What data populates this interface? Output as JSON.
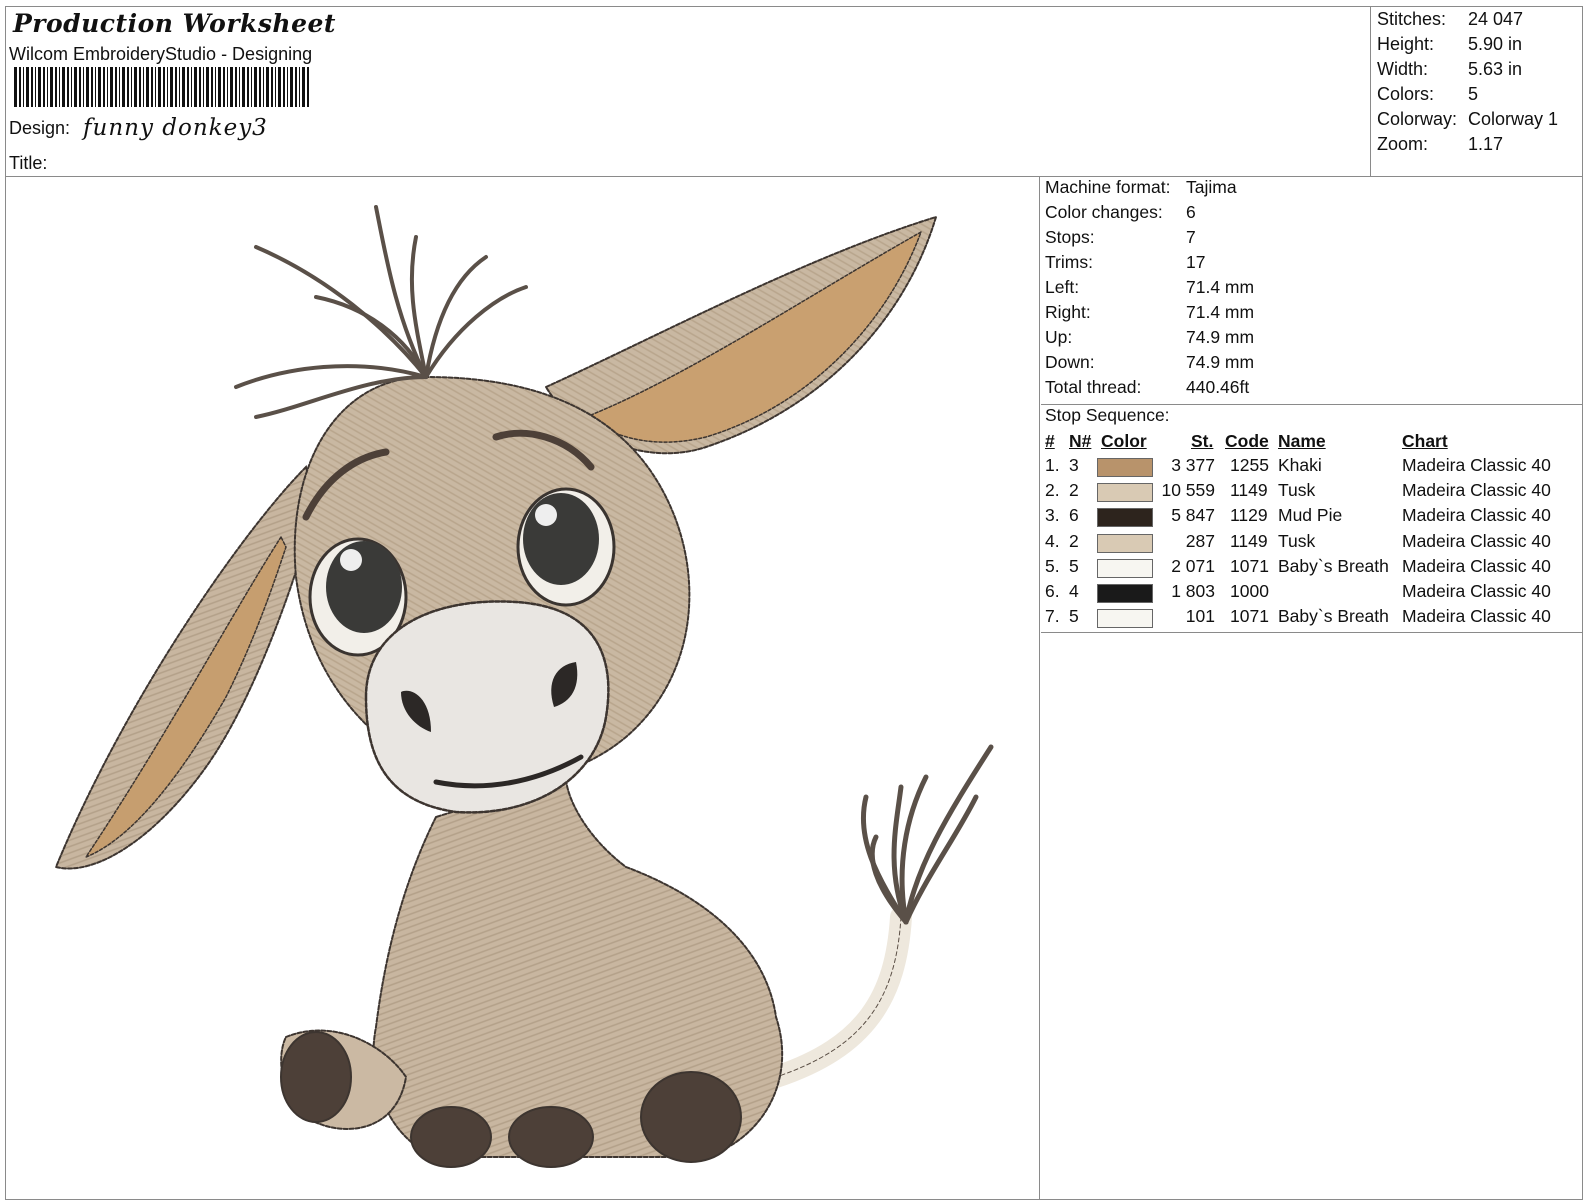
{
  "header": {
    "title": "Production Worksheet",
    "software": "Wilcom EmbroideryStudio - Designing",
    "design_label": "Design:",
    "design_name": "funny donkey3",
    "title_label": "Title:"
  },
  "summary": [
    {
      "label": "Stitches:",
      "value": "24 047"
    },
    {
      "label": "Height:",
      "value": "5.90 in"
    },
    {
      "label": "Width:",
      "value": "5.63 in"
    },
    {
      "label": "Colors:",
      "value": "5"
    },
    {
      "label": "Colorway:",
      "value": "Colorway 1"
    },
    {
      "label": "Zoom:",
      "value": "1.17"
    }
  ],
  "details": [
    {
      "label": "Machine format:",
      "value": "Tajima"
    },
    {
      "label": "Color changes:",
      "value": "6"
    },
    {
      "label": "Stops:",
      "value": "7"
    },
    {
      "label": "Trims:",
      "value": "17"
    },
    {
      "label": "Left:",
      "value": "71.4 mm"
    },
    {
      "label": "Right:",
      "value": "71.4 mm"
    },
    {
      "label": "Up:",
      "value": "74.9 mm"
    },
    {
      "label": "Down:",
      "value": "74.9 mm"
    },
    {
      "label": "Total thread:",
      "value": "440.46ft"
    }
  ],
  "stop_sequence": {
    "title": "Stop Sequence:",
    "headers": {
      "num": "#",
      "needle": "N#",
      "color": "Color",
      "stitches": "St.",
      "code": "Code",
      "name": "Name",
      "chart": "Chart"
    },
    "rows": [
      {
        "num": "1.",
        "needle": "3",
        "color": "#b8936b",
        "stitches": "3 377",
        "code": "1255",
        "name": "Khaki",
        "chart": "Madeira Classic 40"
      },
      {
        "num": "2.",
        "needle": "2",
        "color": "#d9cab4",
        "stitches": "10 559",
        "code": "1149",
        "name": "Tusk",
        "chart": "Madeira Classic 40"
      },
      {
        "num": "3.",
        "needle": "6",
        "color": "#2d241d",
        "stitches": "5 847",
        "code": "1129",
        "name": "Mud Pie",
        "chart": "Madeira Classic 40"
      },
      {
        "num": "4.",
        "needle": "2",
        "color": "#d9cab4",
        "stitches": "287",
        "code": "1149",
        "name": "Tusk",
        "chart": "Madeira Classic 40"
      },
      {
        "num": "5.",
        "needle": "5",
        "color": "#f7f6f1",
        "stitches": "2 071",
        "code": "1071",
        "name": "Baby`s Breath",
        "chart": "Madeira Classic 40"
      },
      {
        "num": "6.",
        "needle": "4",
        "color": "#1a1a1a",
        "stitches": "1 803",
        "code": "1000",
        "name": "",
        "chart": "Madeira Classic 40"
      },
      {
        "num": "7.",
        "needle": "5",
        "color": "#f7f6f1",
        "stitches": "101",
        "code": "1071",
        "name": "Baby`s Breath",
        "chart": "Madeira Classic 40"
      }
    ]
  }
}
